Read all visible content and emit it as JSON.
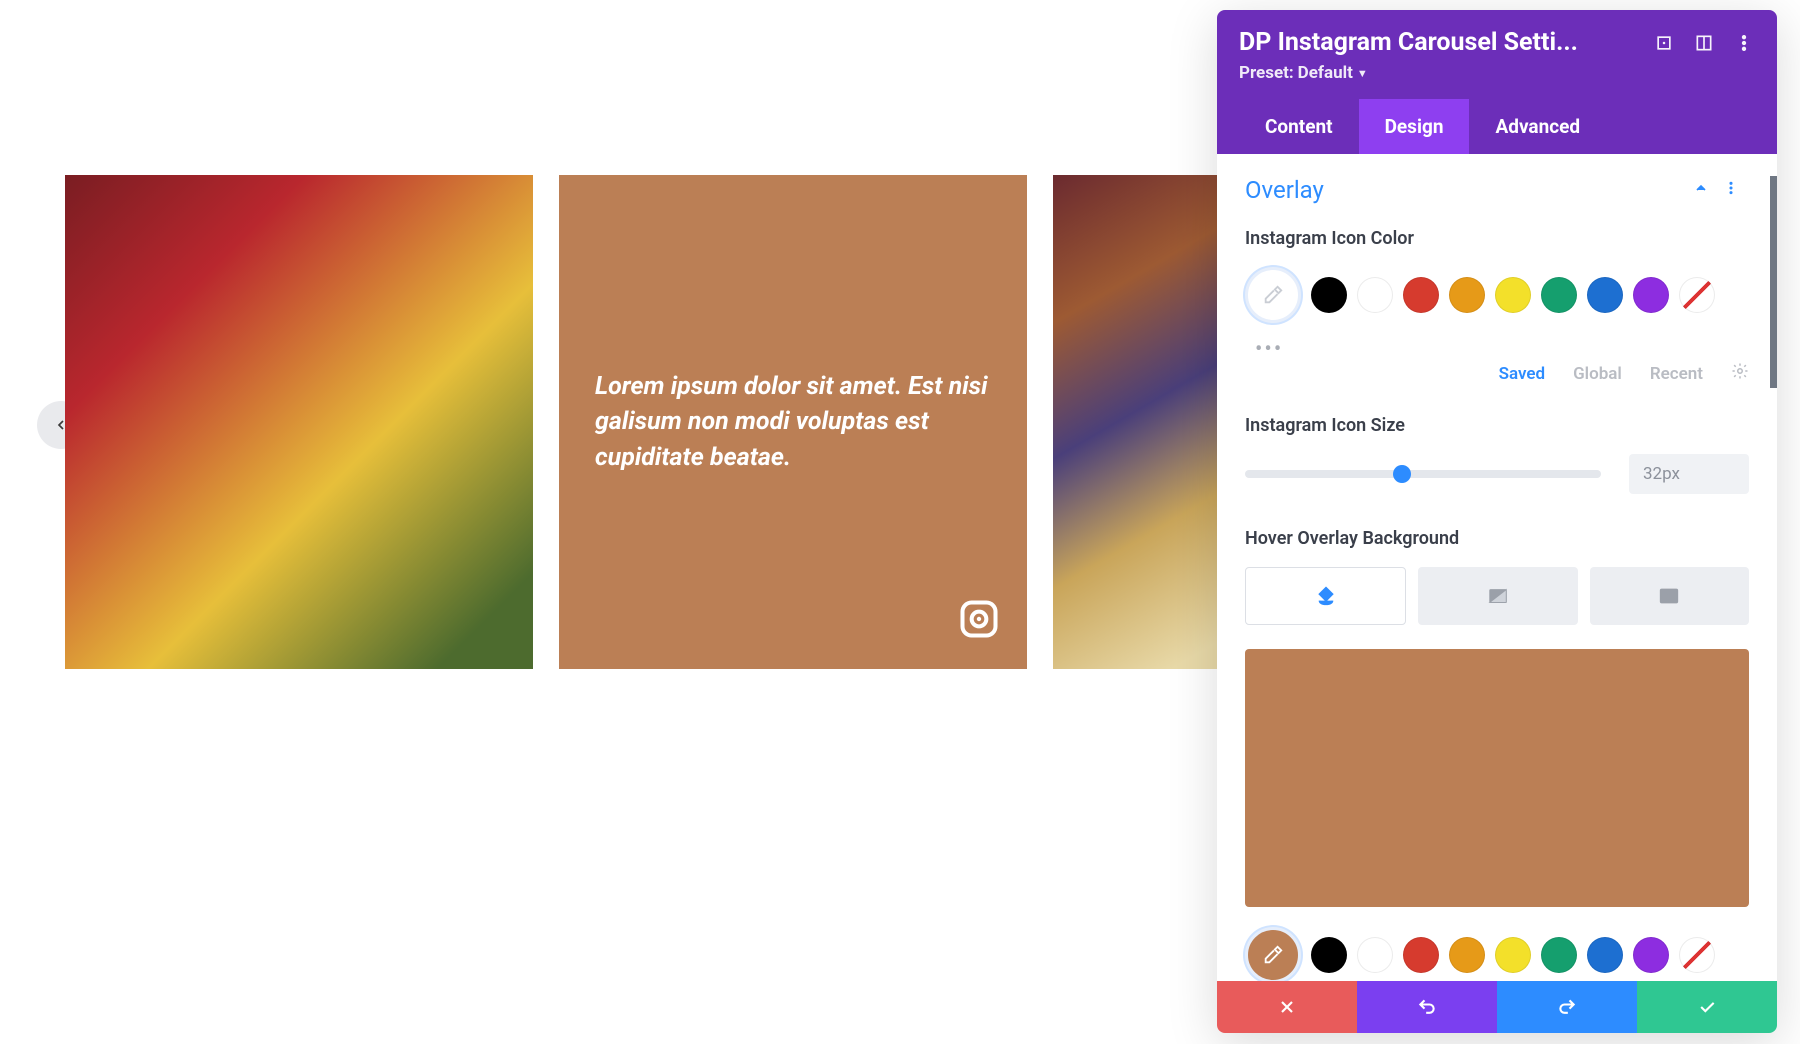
{
  "carousel": {
    "caption": "Lorem ipsum dolor sit amet. Est nisi galisum non modi voluptas est cupiditate beatae.",
    "overlay_bg": "#bb7f55"
  },
  "panel": {
    "title": "DP Instagram Carousel Setti...",
    "preset_label": "Preset:",
    "preset_value": "Default",
    "tabs": {
      "content": "Content",
      "design": "Design",
      "advanced": "Advanced"
    },
    "section_title": "Overlay",
    "icon_color_label": "Instagram Icon Color",
    "icon_color_swatches": [
      "#000000",
      "#ffffff",
      "#d63b2e",
      "#e69a18",
      "#f3e02a",
      "#159f6e",
      "#1d6fd1",
      "#8d2de0"
    ],
    "swatch_tabs": {
      "saved": "Saved",
      "global": "Global",
      "recent": "Recent"
    },
    "icon_size_label": "Instagram Icon Size",
    "icon_size_value": "32px",
    "icon_size_percent": 44,
    "hover_bg_label": "Hover Overlay Background",
    "hover_bg_color": "#bb7f55",
    "hover_bg_swatches": [
      "#000000",
      "#ffffff",
      "#d63b2e",
      "#e69a18",
      "#f3e02a",
      "#159f6e",
      "#1d6fd1",
      "#8d2de0"
    ]
  }
}
